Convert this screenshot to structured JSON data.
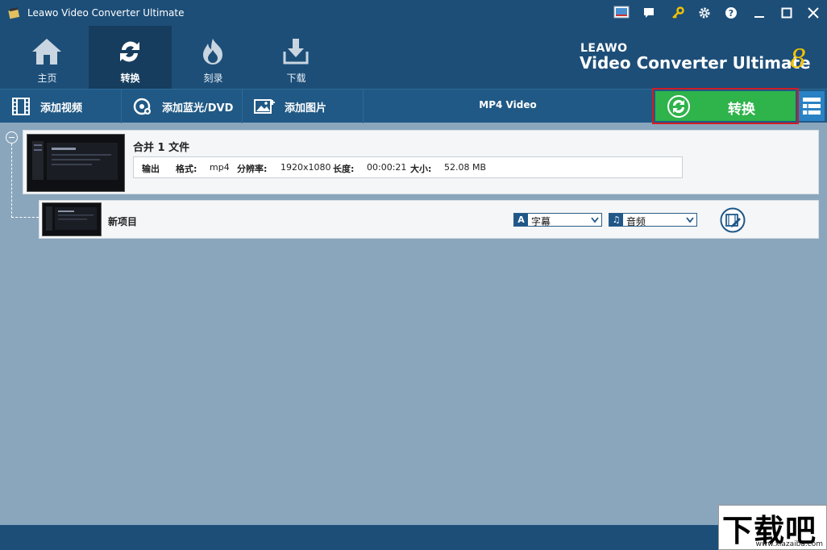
{
  "window": {
    "title": "Leawo Video Converter Ultimate"
  },
  "nav": {
    "tabs": [
      {
        "label": "主页",
        "icon": "home-icon"
      },
      {
        "label": "转换",
        "icon": "convert-icon",
        "active": true
      },
      {
        "label": "刻录",
        "icon": "burn-icon"
      },
      {
        "label": "下载",
        "icon": "download-icon"
      }
    ]
  },
  "brand": {
    "top": "LEAWO",
    "main": "Video Converter Ultimate",
    "version": "8"
  },
  "toolbar": {
    "add_video": "添加视频",
    "add_bluray": "添加蓝光/DVD",
    "add_photo": "添加图片",
    "profile": "MP4 Video",
    "convert": "转换"
  },
  "merge": {
    "title": "合并 1 文件",
    "output_label": "输出",
    "format_label": "格式:",
    "format_value": "mp4",
    "resolution_label": "分辨率:",
    "resolution_value": "1920x1080",
    "duration_label": "长度:",
    "duration_value": "00:00:21",
    "size_label": "大小:",
    "size_value": "52.08 MB"
  },
  "item": {
    "name": "新项目",
    "subtitle_value": "字幕",
    "audio_value": "音频"
  },
  "watermark": {
    "text": "下载吧",
    "url": "www.xiazaiba.com"
  },
  "colors": {
    "titlebar": "#1d4e78",
    "toolbar": "#205985",
    "content_bg": "#8aa6bd",
    "convert_green": "#2fb34b",
    "highlight_red": "#cf1d24"
  }
}
